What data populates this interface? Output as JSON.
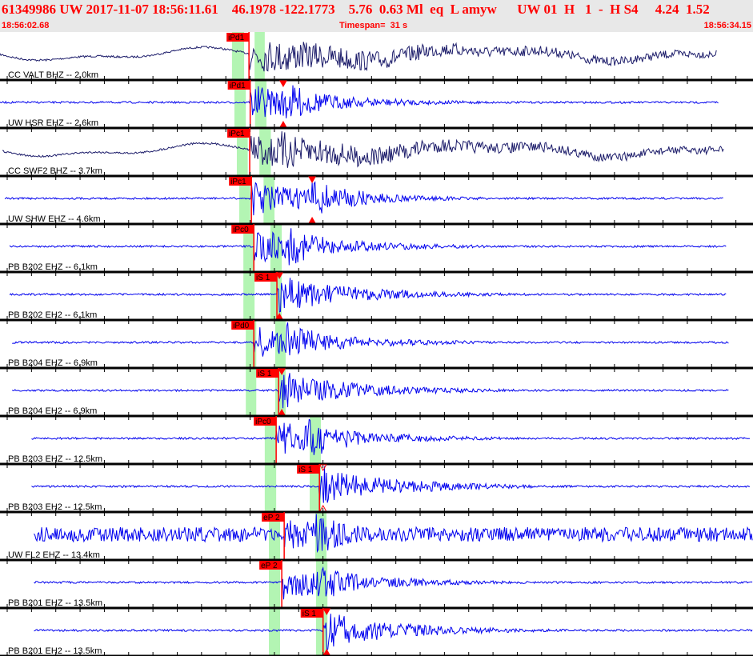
{
  "header": {
    "title": "61349986 UW 2017-11-07 18:56:11.61    46.1978 -122.1773    5.76  0.63 Ml  eq  L amyw      UW 01  H   1  -  H S4     4.24  1.52",
    "start_time": "18:56:02.68",
    "timespan": "Timespan=  31 s",
    "end_time": "18:56:34.15"
  },
  "timespan_s": 31,
  "colors": {
    "header_text": "#ff0000",
    "pick": "#ff0000",
    "window": "#b3f5b3",
    "trace_blue": "#0000ee",
    "trace_navy": "#1c1c6a"
  },
  "traces": [
    {
      "label": "CC VALT BHZ -- 2.0km",
      "color": "navy",
      "pick": {
        "label": "iPd1",
        "t": 10.25
      },
      "windows": [
        [
          9.55,
          10.05
        ],
        [
          10.48,
          10.9
        ]
      ],
      "start": 0.0,
      "end": 29.5,
      "swell": true
    },
    {
      "label": "UW HSR EHZ -- 2.6km",
      "color": "blue",
      "pick": {
        "label": "iPd1",
        "t": 10.3
      },
      "windows": [
        [
          9.65,
          10.12
        ],
        [
          10.5,
          10.97
        ]
      ],
      "marker": 11.66,
      "start": 0.0,
      "end": 29.6
    },
    {
      "label": "CC SWF2 BHZ -- 3.7km",
      "color": "navy",
      "pick": {
        "label": "iPc1",
        "t": 10.28
      },
      "windows": [
        [
          9.75,
          10.2
        ],
        [
          10.68,
          11.15
        ]
      ],
      "start": 0.1,
      "end": 29.8,
      "swell": true
    },
    {
      "label": "UW SHW EHZ -- 4.6km",
      "color": "blue",
      "pick": {
        "label": "iPc1",
        "t": 10.35
      },
      "windows": [
        [
          9.85,
          10.3
        ],
        [
          10.85,
          11.3
        ]
      ],
      "marker": 12.85,
      "start": 0.2,
      "end": 29.8
    },
    {
      "label": "PB B202 EHZ -- 6.1km",
      "color": "blue",
      "pick": {
        "label": "iPc0",
        "t": 10.45
      },
      "windows": [
        [
          10.02,
          10.48
        ],
        [
          11.13,
          11.6
        ]
      ],
      "start": 0.4,
      "end": 29.9
    },
    {
      "label": "PB B202 EH2 -- 6.1km",
      "color": "blue",
      "pick": {
        "label": "iS 1",
        "t": 11.4
      },
      "windows": [
        [
          10.02,
          10.48
        ],
        [
          11.13,
          11.6
        ]
      ],
      "marker": 11.5,
      "start": 0.4,
      "end": 29.9
    },
    {
      "label": "PB B204 EHZ -- 6.9km",
      "color": "blue",
      "pick": {
        "label": "iPd0",
        "t": 10.45
      },
      "windows": [
        [
          10.12,
          10.55
        ],
        [
          11.33,
          11.76
        ]
      ],
      "start": 0.5,
      "end": 30.0
    },
    {
      "label": "PB B204 EH2 -- 6.9km",
      "color": "blue",
      "pick": {
        "label": "iS 1",
        "t": 11.47
      },
      "windows": [
        [
          10.12,
          10.55
        ],
        [
          11.33,
          11.76
        ]
      ],
      "marker": 11.6,
      "start": 0.5,
      "end": 30.0
    },
    {
      "label": "PB B203 EHZ -- 12.5km",
      "color": "blue",
      "pick": {
        "label": "iPc0",
        "t": 11.37
      },
      "windows": [
        [
          10.9,
          11.37
        ],
        [
          12.75,
          13.21
        ]
      ],
      "start": 1.3,
      "end": 30.9
    },
    {
      "label": "PB B203 EH2 -- 12.5km",
      "color": "blue",
      "pick": {
        "label": "iS 1",
        "t": 13.15
      },
      "windows": [
        [
          10.9,
          11.37
        ],
        [
          12.75,
          13.21
        ]
      ],
      "marker": 13.3,
      "hollow": true,
      "start": 1.3,
      "end": 30.9
    },
    {
      "label": "UW FL2 EHZ -- 13.4km",
      "color": "blue",
      "pick": {
        "label": "eP 2",
        "t": 11.7
      },
      "windows": [
        [
          11.07,
          11.53
        ],
        [
          12.98,
          13.44
        ]
      ],
      "start": 1.4,
      "end": 31.0,
      "noisy": true
    },
    {
      "label": "PB B201 EHZ -- 13.5km",
      "color": "blue",
      "pick": {
        "label": "eP 2",
        "t": 11.6
      },
      "windows": [
        [
          11.07,
          11.53
        ],
        [
          13.01,
          13.48
        ]
      ],
      "start": 1.4,
      "end": 31.0
    },
    {
      "label": "PB B201 EH2 -- 13.5km",
      "color": "blue",
      "pick": {
        "label": "iS 1",
        "t": 13.3
      },
      "windows": [
        [
          11.07,
          11.53
        ],
        [
          13.01,
          13.48
        ]
      ],
      "marker": 13.45,
      "start": 1.4,
      "end": 31.0
    }
  ]
}
